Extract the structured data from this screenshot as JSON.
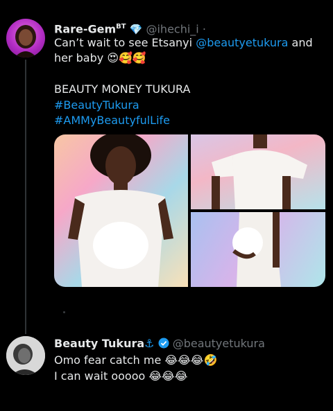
{
  "tweet1": {
    "name": "Rare-Gem",
    "name_sup": "BT",
    "badge": "💎",
    "handle": "@ihechi_i",
    "separator": "·",
    "line1_prefix": "Can’t wait to see Etsanyi ",
    "line1_mention": "@beautyetukura",
    "line1_suffix": " and",
    "line2": "her baby 😍🥰🥰",
    "line3": "BEAUTY MONEY TUKURA",
    "hashtag1": "#BeautyTukura",
    "hashtag2": "#AMMyBeautyfulLife"
  },
  "tweet2": {
    "name": "Beauty Tukura",
    "anchor": "⚓",
    "handle": "@beautyetukura",
    "line1": "Omo fear catch me 😂😂😂🤣",
    "line2": "I can wait ooooo 😂😂😂"
  },
  "colors": {
    "background": "#000000",
    "text": "#e7e9ea",
    "muted": "#71767b",
    "link": "#1d9bf0"
  }
}
